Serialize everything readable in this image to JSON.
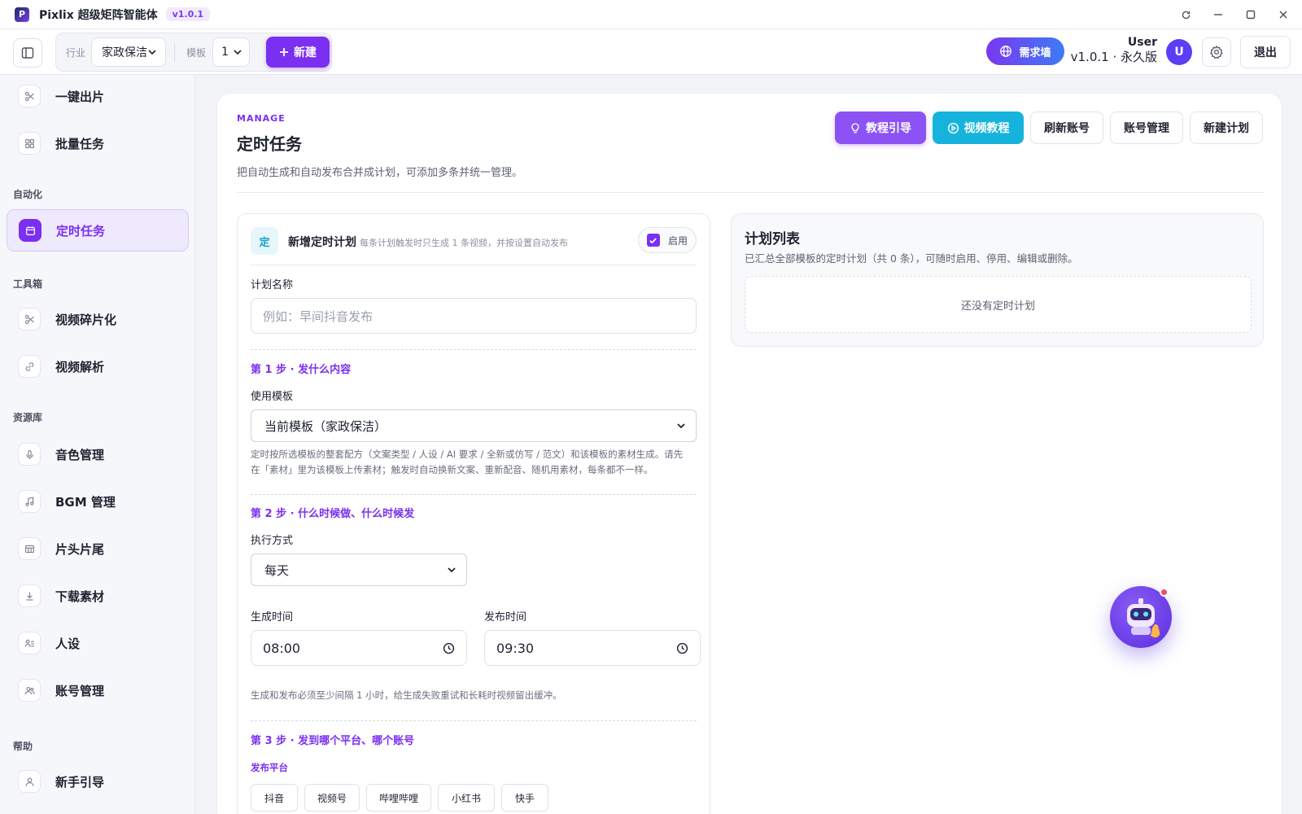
{
  "titlebar": {
    "app_title": "Pixlix 超级矩阵智能体",
    "version": "v1.0.1"
  },
  "toolbar": {
    "industry_label": "行业",
    "industry_value": "家政保洁",
    "template_label": "模板",
    "template_value": "1",
    "new_label": "新建",
    "demand_label": "需求墙",
    "user_name": "User",
    "user_plan": "v1.0.1 · 永久版",
    "avatar_letter": "U",
    "logout_label": "退出"
  },
  "sidebar": {
    "top_items": [
      {
        "label": "一键出片",
        "icon": "scissors-icon"
      },
      {
        "label": "批量任务",
        "icon": "grid-icon"
      }
    ],
    "automation_title": "自动化",
    "automation_items": [
      {
        "label": "定时任务",
        "icon": "calendar-icon",
        "active": true
      }
    ],
    "toolbox_title": "工具箱",
    "toolbox_items": [
      {
        "label": "视频碎片化",
        "icon": "scissors-icon"
      },
      {
        "label": "视频解析",
        "icon": "link-icon"
      }
    ],
    "resources_title": "资源库",
    "resources_items": [
      {
        "label": "音色管理",
        "icon": "mic-icon"
      },
      {
        "label": "BGM 管理",
        "icon": "music-icon"
      },
      {
        "label": "片头片尾",
        "icon": "film-icon"
      },
      {
        "label": "下载素材",
        "icon": "download-icon"
      },
      {
        "label": "人设",
        "icon": "persona-icon"
      },
      {
        "label": "账号管理",
        "icon": "users-icon"
      }
    ],
    "help_title": "帮助",
    "help_items": [
      {
        "label": "新手引导",
        "icon": "user-icon"
      }
    ]
  },
  "main": {
    "kicker": "MANAGE",
    "title": "定时任务",
    "subtitle": "把自动生成和自动发布合并成计划，可添加多条并统一管理。",
    "buttons": {
      "guide": "教程引导",
      "video_tutorial": "视频教程",
      "refresh_accounts": "刷新账号",
      "account_mgmt": "账号管理",
      "new_plan": "新建计划"
    }
  },
  "form": {
    "badge": "定",
    "title": "新增定时计划",
    "hint": "每条计划触发时只生成 1 条视频，并按设置自动发布",
    "enable_label": "启用",
    "enabled": true,
    "plan_name_label": "计划名称",
    "plan_name_placeholder": "例如：早间抖音发布",
    "step1_title": "第 1 步 · 发什么内容",
    "template_label": "使用模板",
    "template_value": "当前模板（家政保洁）",
    "template_note_line1": "定时按所选模板的整套配方（文案类型 / 人设 / AI 要求 / 全新或仿写 / 范文）和该模板的素材生成。请先",
    "template_note_line2": "在「素材」里为该模板上传素材；触发时自动换新文案、重新配音、随机用素材，每条都不一样。",
    "step2_title": "第 2 步 · 什么时候做、什么时候发",
    "exec_label": "执行方式",
    "exec_value": "每天",
    "gen_time_label": "生成时间",
    "gen_time_value": "08:00",
    "pub_time_label": "发布时间",
    "pub_time_value": "09:30",
    "time_note": "生成和发布必须至少间隔 1 小时，给生成失败重试和长耗时视频留出缓冲。",
    "step3_title": "第 3 步 · 发到哪个平台、哪个账号",
    "platform_label": "发布平台",
    "platforms": [
      "抖音",
      "视频号",
      "哔哩哔哩",
      "小红书",
      "快手"
    ]
  },
  "plan_list": {
    "title": "计划列表",
    "subtitle": "已汇总全部模板的定时计划（共 0 条），可随时启用、停用、编辑或删除。",
    "empty": "还没有定时计划"
  },
  "colors": {
    "accent": "#7b2ff0",
    "cyan": "#16b3dc",
    "alert": "#f04e5e"
  }
}
